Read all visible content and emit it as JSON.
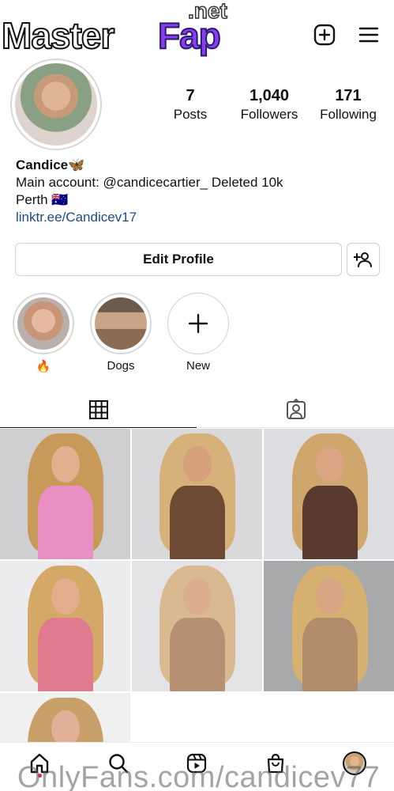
{
  "watermark": {
    "brand_left": "Master",
    "brand_right": "Fap",
    "brand_suffix": ".net",
    "bottom": "OnlyFans.com/candicev77"
  },
  "header": {
    "create_icon": "plus-square-icon",
    "menu_icon": "hamburger-menu-icon"
  },
  "profile": {
    "stats": [
      {
        "value": "7",
        "label": "Posts"
      },
      {
        "value": "1,040",
        "label": "Followers"
      },
      {
        "value": "171",
        "label": "Following"
      }
    ],
    "name": "Candice🦋",
    "bio_line1": "Main account: @candicecartier_ Deleted 10k",
    "bio_line2": "Perth 🇦🇺",
    "link": "linktr.ee/Candicev17"
  },
  "actions": {
    "edit_profile": "Edit Profile",
    "discover_icon": "add-person-icon"
  },
  "highlights": [
    {
      "label": "🔥"
    },
    {
      "label": "Dogs"
    },
    {
      "label": "New"
    }
  ],
  "tabs": {
    "grid_icon": "grid-icon",
    "tagged_icon": "tagged-person-icon"
  },
  "grid": {
    "posts": [
      {
        "bg": "#cfcfd2",
        "dress": "#e98fc3",
        "hair": "#c89a5a",
        "skin": "#e2b08e"
      },
      {
        "bg": "#d9d9db",
        "dress": "#6e4a35",
        "hair": "#d6b27a",
        "skin": "#d6a07c"
      },
      {
        "bg": "#dcdde0",
        "dress": "#5a3a2e",
        "hair": "#cfa66b",
        "skin": "#d9a583"
      },
      {
        "bg": "#ececee",
        "dress": "#e07a8e",
        "hair": "#d4a867",
        "skin": "#e3ad8c"
      },
      {
        "bg": "#e3e3e5",
        "dress": "#b78f72",
        "hair": "#d9b98f",
        "skin": "#dcae8e"
      },
      {
        "bg": "#a8a9ab",
        "dress": "#b38c6c",
        "hair": "#d5b071",
        "skin": "#d7a582"
      },
      {
        "bg": "#f0f0f1",
        "dress": "#e2b8a0",
        "hair": "#c9a06a",
        "skin": "#e0b196"
      }
    ]
  },
  "bottom_nav": [
    {
      "icon": "home-icon"
    },
    {
      "icon": "search-icon"
    },
    {
      "icon": "reels-icon"
    },
    {
      "icon": "shop-icon"
    },
    {
      "icon": "profile-avatar-icon"
    }
  ]
}
